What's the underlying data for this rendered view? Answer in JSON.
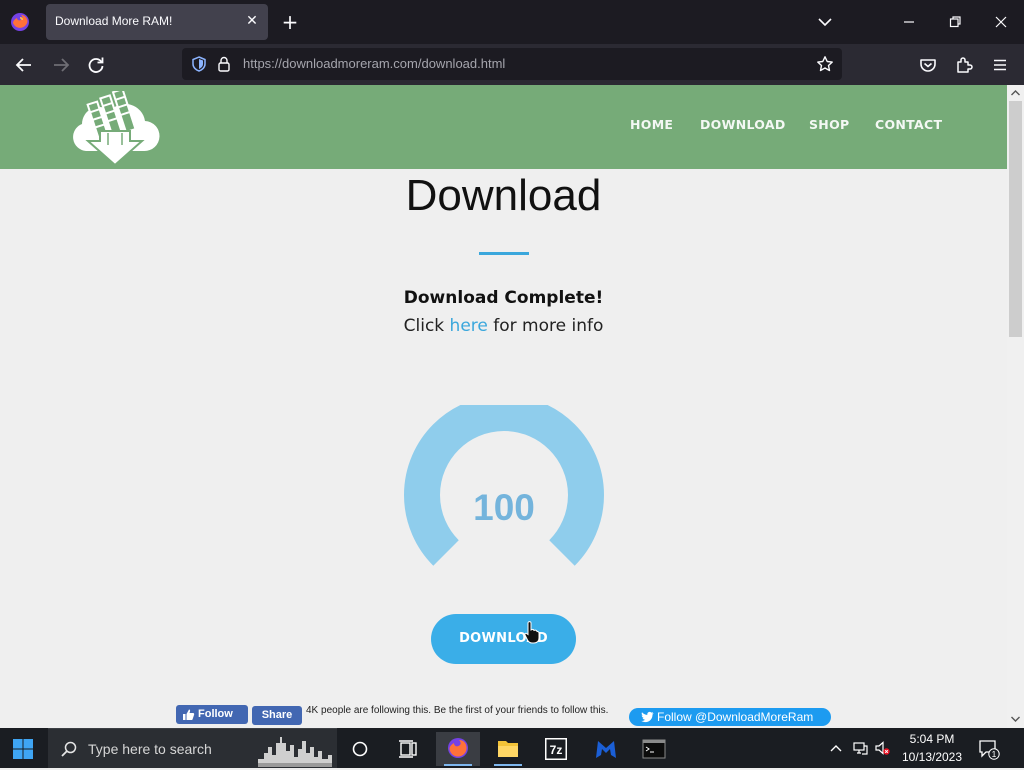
{
  "browser": {
    "tab_title": "Download More RAM!",
    "tab_close": "✕",
    "new_tab": "+",
    "url_host": "https://downloadmoreram.com",
    "url_path": "/download.html"
  },
  "site": {
    "nav": [
      "HOME",
      "DOWNLOAD",
      "SHOP",
      "CONTACT"
    ],
    "title": "Download",
    "status_heading": "Download Complete!",
    "info_prefix": "Click ",
    "info_link": "here",
    "info_suffix": " for more info",
    "gauge_value": "100",
    "gauge_fraction": 1.0,
    "download_button": "DOWNLOAD",
    "accent_color": "#3aa7dc",
    "header_color": "#76ab78"
  },
  "social": {
    "fb_follow": "Follow",
    "fb_share": "Share",
    "fb_text": "4K people are following this. Be the first of your friends to follow this.",
    "twitter_follow": "Follow @DownloadMoreRam"
  },
  "taskbar": {
    "search_placeholder": "Type here to search",
    "time": "5:04 PM",
    "date": "10/13/2023",
    "notification_count": "1"
  }
}
